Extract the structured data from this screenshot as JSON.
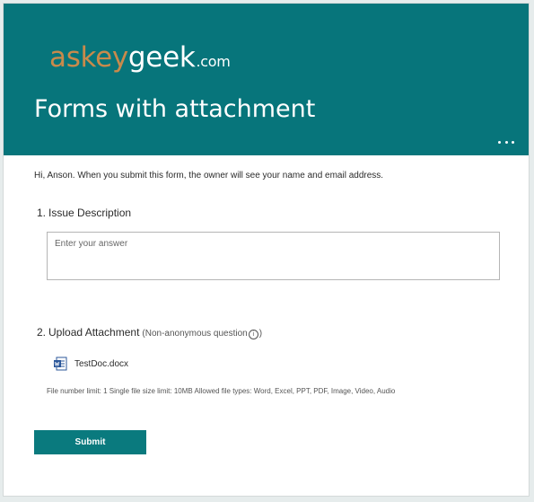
{
  "header": {
    "logo_part1": "askey",
    "logo_part2": "geek",
    "logo_part3": ".com",
    "title": "Forms with attachment",
    "more_label": "..."
  },
  "notice": "Hi, Anson. When you submit this form, the owner will see your name and email address.",
  "questions": [
    {
      "number": "1.",
      "title": "Issue Description",
      "placeholder": "Enter your answer"
    },
    {
      "number": "2.",
      "title": "Upload Attachment",
      "note_open": "(Non-anonymous question",
      "note_close": ")",
      "file": {
        "name": "TestDoc.docx",
        "icon": "word-document-icon"
      },
      "limits": "File number limit: 1   Single file size limit: 10MB   Allowed file types: Word, Excel, PPT, PDF, Image, Video, Audio"
    }
  ],
  "submit_label": "Submit",
  "colors": {
    "header_bg": "#07757b",
    "logo_accent": "#c98a4b",
    "button_bg": "#0a7a7e"
  }
}
